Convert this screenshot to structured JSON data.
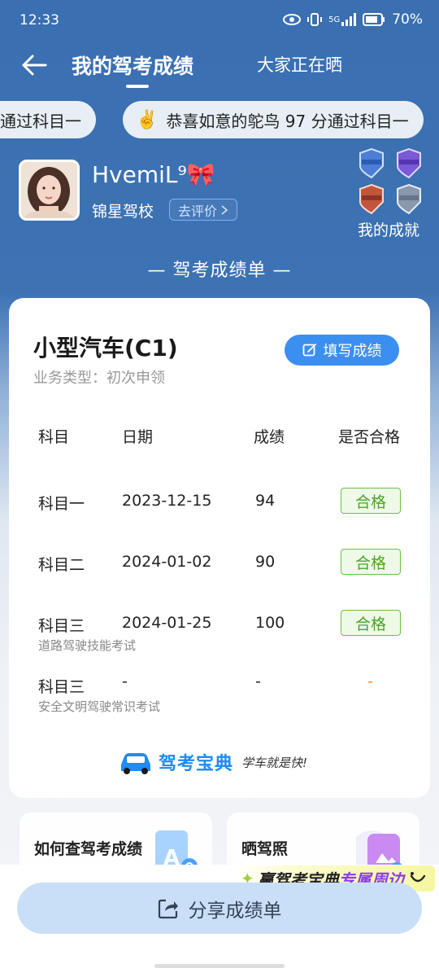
{
  "status_bar": {
    "time": "12:33",
    "network": "5G",
    "battery": "70%"
  },
  "nav": {
    "title": "我的驾考成绩",
    "tab": "大家正在晒"
  },
  "marquee": [
    {
      "text": "通过科目一"
    },
    {
      "emoji": "✌️",
      "text": "恭喜如意的鸵鸟 97 分通过科目一"
    }
  ],
  "profile": {
    "username": "HvemiL⁹🎀",
    "school": "锦星驾校",
    "rate_label": "去评价",
    "achievements_label": "我的成就"
  },
  "section_title": "— 驾考成绩单 —",
  "card": {
    "car_type": "小型汽车(C1)",
    "business_type": "业务类型：初次申领",
    "fill_button": "填写成绩",
    "columns": [
      "科目",
      "日期",
      "成绩",
      "是否合格"
    ],
    "rows": [
      {
        "subject": "科目一",
        "note": "",
        "date": "2023-12-15",
        "score": "94",
        "result": "合格"
      },
      {
        "subject": "科目二",
        "note": "",
        "date": "2024-01-02",
        "score": "90",
        "result": "合格"
      },
      {
        "subject": "科目三",
        "note": "道路驾驶技能考试",
        "date": "2024-01-25",
        "score": "100",
        "result": "合格"
      },
      {
        "subject": "科目三",
        "note": "安全文明驾驶常识考试",
        "date": "-",
        "score": "-",
        "result": "-"
      }
    ],
    "brand_name": "驾考宝典",
    "brand_slogan": "学车就是快!"
  },
  "bottom_cards": [
    {
      "label": "如何查驾考成绩"
    },
    {
      "label": "晒驾照"
    }
  ],
  "promo": {
    "prefix": "赢驾考宝典",
    "accent": "专属周边"
  },
  "share_button": "分享成绩单",
  "colors": {
    "header_blue": "#3a6fb1",
    "primary_button": "#3b8ff0",
    "pass_green": "#4aa526",
    "share_button_bg": "#c9dff7"
  }
}
